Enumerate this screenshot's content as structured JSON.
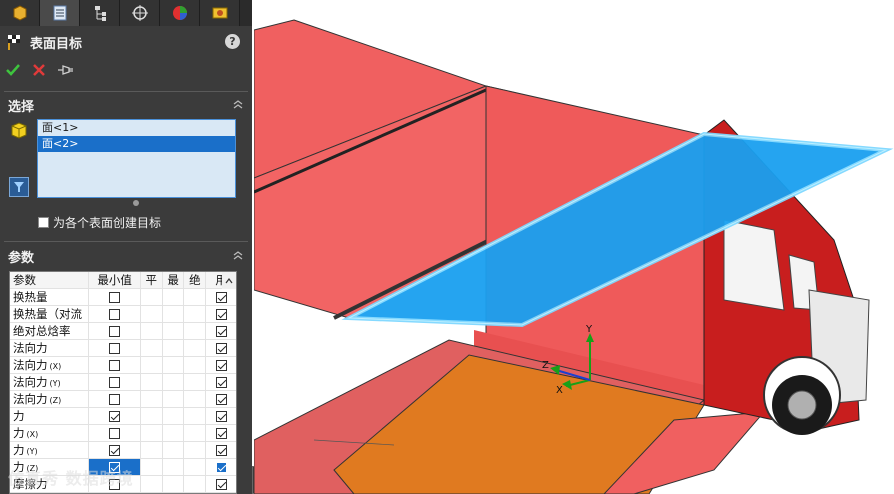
{
  "panel": {
    "tabs": [
      {
        "icon": "feature-manager-icon"
      },
      {
        "icon": "property-manager-icon"
      },
      {
        "icon": "configuration-manager-icon"
      },
      {
        "icon": "dimxpert-icon"
      },
      {
        "icon": "display-manager-icon"
      },
      {
        "icon": "flow-simulation-icon"
      }
    ],
    "title": "表面目标",
    "help": "?",
    "selection": {
      "heading": "选择",
      "items": [
        "面<1>",
        "面<2>"
      ],
      "selected_index": 1,
      "create_each_label": "为各个表面创建目标"
    },
    "parameters": {
      "heading": "参数",
      "columns": [
        "参数",
        "最小值",
        "平",
        "最",
        "绝",
        "用"
      ],
      "rows": [
        {
          "name": "换热量",
          "sub": "",
          "min": false,
          "use": true
        },
        {
          "name": "换热量（对流",
          "sub": "",
          "min": false,
          "use": true
        },
        {
          "name": "绝对总焓率",
          "sub": "",
          "min": false,
          "use": true
        },
        {
          "name": "法向力",
          "sub": "",
          "min": false,
          "use": true
        },
        {
          "name": "法向力",
          "sub": "(X)",
          "min": false,
          "use": true
        },
        {
          "name": "法向力",
          "sub": "(Y)",
          "min": false,
          "use": true
        },
        {
          "name": "法向力",
          "sub": "(Z)",
          "min": false,
          "use": true
        },
        {
          "name": "力",
          "sub": "",
          "min": true,
          "use": true
        },
        {
          "name": "力",
          "sub": "(X)",
          "min": false,
          "use": true
        },
        {
          "name": "力",
          "sub": "(Y)",
          "min": true,
          "use": true
        },
        {
          "name": "力",
          "sub": "(Z)",
          "min": true,
          "use": true,
          "highlight": true
        },
        {
          "name": "摩擦力",
          "sub": "",
          "min": false,
          "use": true
        }
      ]
    },
    "watermark": "仿真秀 数据跨境"
  },
  "triad": {
    "x_label": "X",
    "y_label": "Y",
    "z_label": "Z"
  },
  "colors": {
    "panel_bg": "#3b3b3b",
    "selected": "#1a6fc9",
    "trailer_red": "#f06060",
    "floor_orange": "#e07a20",
    "highlight_blue": "#1aa0f0",
    "cab_red": "#c81e1e"
  }
}
